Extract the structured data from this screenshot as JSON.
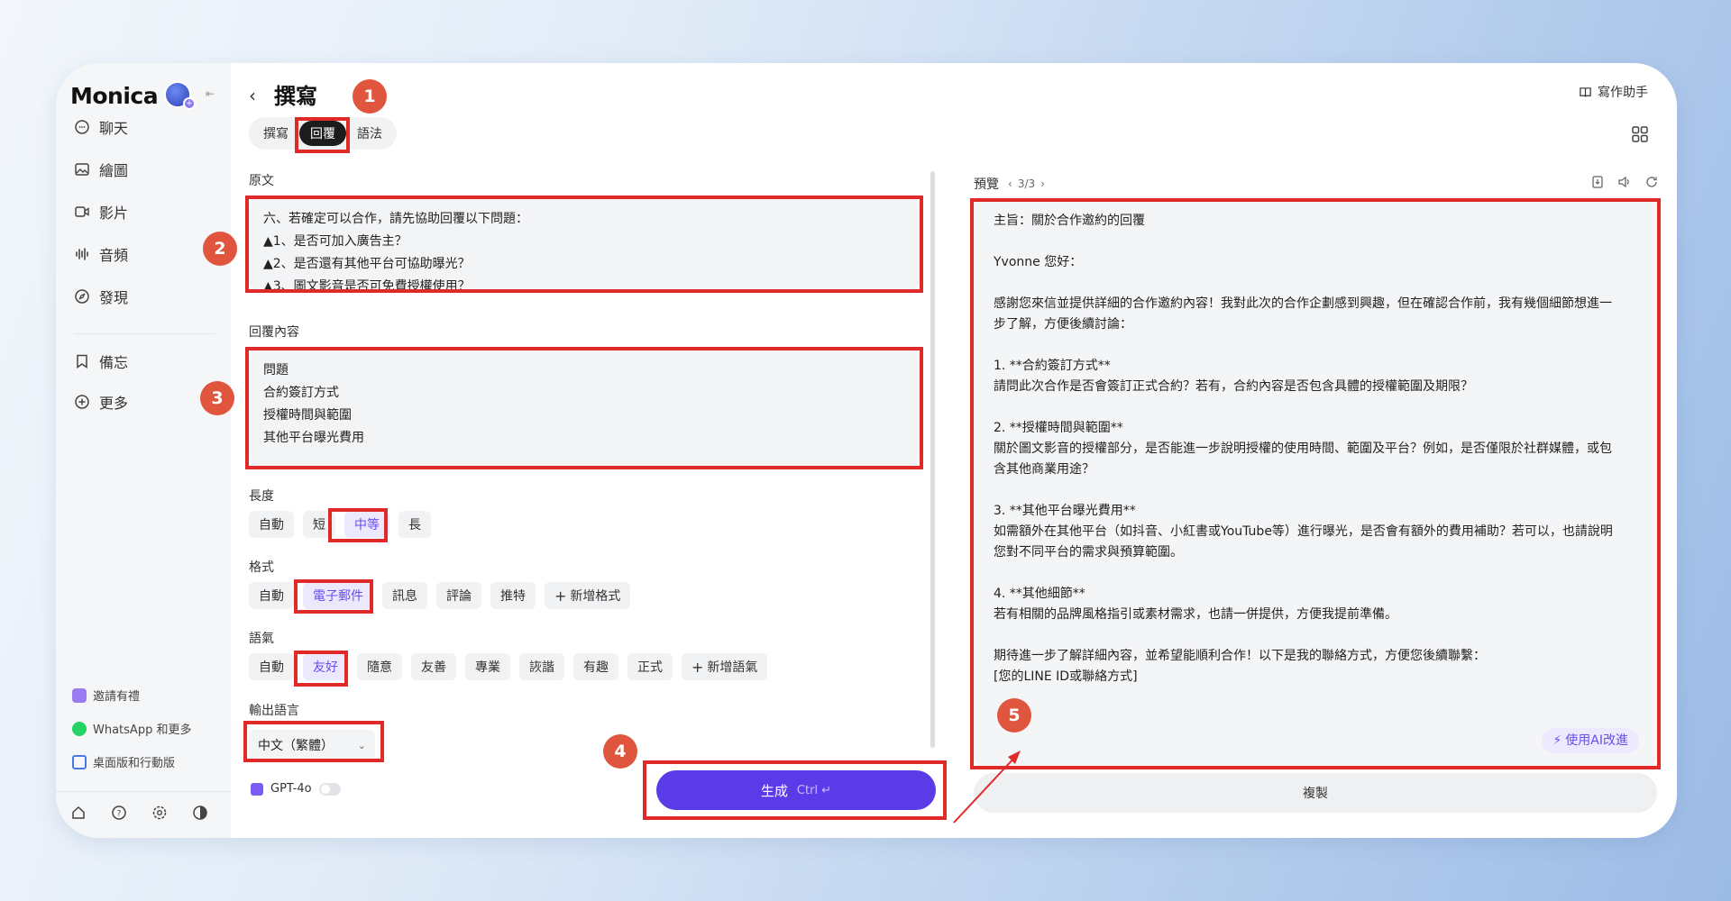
{
  "sidebar": {
    "brand": "Monica",
    "nav": [
      {
        "label": "聊天",
        "icon": "chat-icon"
      },
      {
        "label": "繪圖",
        "icon": "image-icon"
      },
      {
        "label": "影片",
        "icon": "video-icon"
      },
      {
        "label": "音頻",
        "icon": "audio-icon"
      },
      {
        "label": "發現",
        "icon": "compass-icon"
      },
      {
        "label": "備忘",
        "icon": "bookmark-icon"
      },
      {
        "label": "更多",
        "icon": "plus-circle-icon"
      }
    ],
    "links": [
      {
        "label": "邀請有禮",
        "icon": "gift-icon"
      },
      {
        "label": "WhatsApp 和更多",
        "icon": "whatsapp-icon"
      },
      {
        "label": "桌面版和行動版",
        "icon": "desktop-icon"
      }
    ]
  },
  "header": {
    "title": "撰寫",
    "assistant": "寫作助手",
    "tabs": [
      "撰寫",
      "回覆",
      "語法"
    ],
    "active_tab": "回覆"
  },
  "form": {
    "original_label": "原文",
    "original_lines": [
      "六、若確定可以合作，請先協助回覆以下問題：",
      "▲1、是否可加入廣告主？",
      "▲2、是否還有其他平台可協助曝光？",
      "▲3、圖文影音是否可免費授權使用？"
    ],
    "reply_label": "回覆內容",
    "reply_lines": [
      "問題",
      "合約簽訂方式",
      "授權時間與範圍",
      "其他平台曝光費用"
    ],
    "length_label": "長度",
    "length_options": [
      "自動",
      "短",
      "中等",
      "長"
    ],
    "format_label": "格式",
    "format_options": [
      "自動",
      "電子郵件",
      "訊息",
      "評論",
      "推特"
    ],
    "format_add": "新增格式",
    "tone_label": "語氣",
    "tone_options": [
      "自動",
      "友好",
      "隨意",
      "友善",
      "專業",
      "詼諧",
      "有趣",
      "正式"
    ],
    "tone_add": "新增語氣",
    "lang_label": "輸出語言",
    "lang_value": "中文（繁體）",
    "model": "GPT-4o",
    "generate": "生成",
    "generate_kbd": "Ctrl ↵"
  },
  "preview": {
    "label": "預覽",
    "pager": "3/3",
    "lines": [
      "主旨：關於合作邀約的回覆",
      "",
      "Yvonne 您好：",
      "",
      "感謝您來信並提供詳細的合作邀約內容！我對此次的合作企劃感到興趣，但在確認合作前，我有幾個細節想進一",
      "步了解，方便後續討論：",
      "",
      "1. **合約簽訂方式**",
      "請問此次合作是否會簽訂正式合約？若有，合約內容是否包含具體的授權範圍及期限？",
      "",
      "2. **授權時間與範圍**",
      "關於圖文影音的授權部分，是否能進一步說明授權的使用時間、範圍及平台？例如，是否僅限於社群媒體，或包",
      "含其他商業用途？",
      "",
      "3. **其他平台曝光費用**",
      "如需額外在其他平台（如抖音、小紅書或YouTube等）進行曝光，是否會有額外的費用補助？若可以，也請說明",
      "您對不同平台的需求與預算範圍。",
      "",
      "4. **其他細節**",
      "若有相關的品牌風格指引或素材需求，也請一併提供，方便我提前準備。",
      "",
      "期待進一步了解詳細內容，並希望能順利合作！以下是我的聯絡方式，方便您後續聯繫：",
      "[您的LINE ID或聯絡方式]"
    ],
    "improve": "使用AI改進",
    "copy": "複製"
  },
  "annotations": [
    "1",
    "2",
    "3",
    "4",
    "5"
  ],
  "colors": {
    "accent": "#5b3be8",
    "annotation": "#e02a2a",
    "marker": "#e0553d"
  }
}
